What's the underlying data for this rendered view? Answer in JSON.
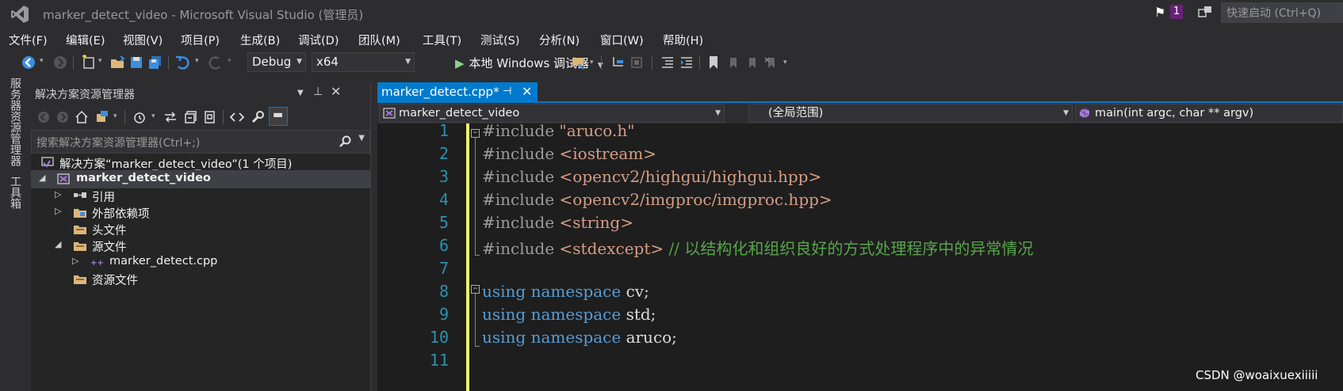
{
  "window": {
    "title": "marker_detect_video - Microsoft Visual Studio (管理员)",
    "notification_count": "1",
    "quick_launch_placeholder": "快速启动 (Ctrl+Q)"
  },
  "menu": [
    "文件(F)",
    "编辑(E)",
    "视图(V)",
    "项目(P)",
    "生成(B)",
    "调试(D)",
    "团队(M)",
    "工具(T)",
    "测试(S)",
    "分析(N)",
    "窗口(W)",
    "帮助(H)"
  ],
  "toolbar": {
    "config": "Debug",
    "platform": "x64",
    "run_label": "本地 Windows 调试器"
  },
  "side_tabs": [
    "服务器资源管理器",
    "工具箱"
  ],
  "solution_explorer": {
    "title": "解决方案资源管理器",
    "search_placeholder": "搜索解决方案资源管理器(Ctrl+;)",
    "tree": [
      {
        "label": "解决方案“marker_detect_video”(1 个项目)",
        "icon": "solution-icon"
      },
      {
        "label": "marker_detect_video",
        "icon": "project-icon",
        "selected": true
      },
      {
        "label": "引用",
        "icon": "references-icon"
      },
      {
        "label": "外部依赖项",
        "icon": "external-deps-icon"
      },
      {
        "label": "头文件",
        "icon": "folder-icon"
      },
      {
        "label": "源文件",
        "icon": "folder-icon"
      },
      {
        "label": "marker_detect.cpp",
        "icon": "cpp-file-icon"
      },
      {
        "label": "资源文件",
        "icon": "folder-icon"
      }
    ]
  },
  "editor": {
    "tab_label": "marker_detect.cpp*",
    "nav_project": "marker_detect_video",
    "nav_scope": "(全局范围)",
    "nav_member": "main(int argc, char ** argv)",
    "lines": [
      {
        "no": "1",
        "pre": "#include ",
        "str": "\"aruco.h\"",
        "cmt": ""
      },
      {
        "no": "2",
        "pre": "#include ",
        "str": "<iostream>",
        "cmt": ""
      },
      {
        "no": "3",
        "pre": "#include ",
        "str": "<opencv2/highgui/highgui.hpp>",
        "cmt": ""
      },
      {
        "no": "4",
        "pre": "#include ",
        "str": "<opencv2/imgproc/imgproc.hpp>",
        "cmt": ""
      },
      {
        "no": "5",
        "pre": "#include ",
        "str": "<string>",
        "cmt": ""
      },
      {
        "no": "6",
        "pre": "#include ",
        "str": "<stdexcept>",
        "cmt": " // 以结构化和组织良好的方式处理程序中的异常情况"
      },
      {
        "no": "7",
        "pre": "",
        "str": "",
        "cmt": ""
      },
      {
        "no": "8",
        "kw": "using namespace",
        "rest": " cv;"
      },
      {
        "no": "9",
        "kw": "using namespace",
        "rest": " std;"
      },
      {
        "no": "10",
        "kw": "using namespace",
        "rest": " aruco;"
      },
      {
        "no": "11",
        "pre": "",
        "str": "",
        "cmt": ""
      }
    ]
  },
  "watermark": "CSDN @woaixuexiiiii",
  "colors": {
    "accent": "#007acc",
    "change_bar": "#eff46f",
    "keyword": "#569cd6",
    "string": "#d69d85",
    "comment": "#57a64a",
    "line_number": "#2b91af"
  }
}
